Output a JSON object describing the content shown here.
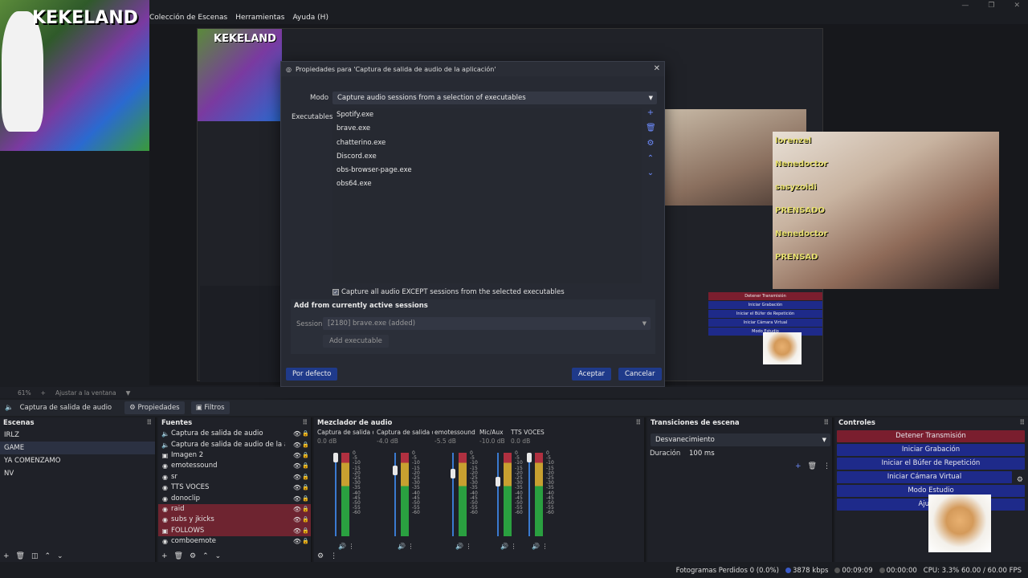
{
  "app": {
    "menu": [
      "Colección de Escenas",
      "Herramientas",
      "Ayuda (H)"
    ]
  },
  "preview": {
    "logo_text": "KEKELAND",
    "chat_names": [
      "lorenzel",
      "Nenedoctor",
      "sasyzoidi",
      "PRENSADO",
      "Nenedoctor",
      "PRENSAD"
    ]
  },
  "dialog": {
    "title": "Propiedades para 'Captura de salida de audio de la aplicación'",
    "mode_label": "Modo",
    "mode_value": "Capture audio sessions from a selection of executables",
    "executables_label": "Executables",
    "executables": [
      "Spotify.exe",
      "brave.exe",
      "chatterino.exe",
      "Discord.exe",
      "obs-browser-page.exe",
      "obs64.exe"
    ],
    "except_label": "Capture all audio EXCEPT sessions from the selected executables",
    "except_checked": true,
    "add_heading": "Add from currently active sessions",
    "session_label": "Session",
    "session_value": "[2180] brave.exe (added)",
    "add_executable": "Add executable",
    "defaults": "Por defecto",
    "ok": "Aceptar",
    "cancel": "Cancelar"
  },
  "zoom": {
    "percent": "61%",
    "fit": "Ajustar a la ventana"
  },
  "source_toolbar": {
    "name": "Captura de salida de audio",
    "properties": "Propiedades",
    "filters": "Filtros"
  },
  "scenes": {
    "title": "Escenas",
    "items": [
      "IRLZ",
      "GAME",
      "YA COMENZAMO",
      "NV"
    ],
    "selected_index": 1
  },
  "sources": {
    "title": "Fuentes",
    "items": [
      {
        "name": "Captura de salida de audio",
        "icon": "speaker-icon",
        "highlight": false
      },
      {
        "name": "Captura de salida de audio de la apli",
        "icon": "speaker-icon",
        "highlight": false
      },
      {
        "name": "Imagen 2",
        "icon": "image-icon",
        "highlight": false
      },
      {
        "name": "emotessound",
        "icon": "globe-icon",
        "highlight": false
      },
      {
        "name": "sr",
        "icon": "globe-icon",
        "highlight": false
      },
      {
        "name": "TTS VOCES",
        "icon": "globe-icon",
        "highlight": false
      },
      {
        "name": "donoclip",
        "icon": "globe-icon",
        "highlight": false
      },
      {
        "name": "raid",
        "icon": "globe-icon",
        "highlight": true
      },
      {
        "name": "subs y jkicks",
        "icon": "globe-icon",
        "highlight": true
      },
      {
        "name": "FOLLOWS",
        "icon": "image-icon",
        "highlight": true
      },
      {
        "name": "comboemote",
        "icon": "globe-icon",
        "highlight": false
      }
    ]
  },
  "mixer": {
    "title": "Mezclador de audio",
    "scale": [
      "0",
      "-5",
      "-10",
      "-15",
      "-20",
      "-25",
      "-30",
      "-35",
      "-40",
      "-45",
      "-50",
      "-55",
      "-60"
    ],
    "channels": [
      {
        "name": "Captura de salida de",
        "db": "0.0 dB"
      },
      {
        "name": "Captura de salida de",
        "db": "-4.0 dB"
      },
      {
        "name": "emotessound",
        "db": "-5.5 dB"
      },
      {
        "name": "Mic/Aux",
        "db": "-10.0 dB"
      },
      {
        "name": "TTS VOCES",
        "db": "0.0 dB"
      }
    ]
  },
  "transitions": {
    "title": "Transiciones de escena",
    "selected": "Desvanecimiento",
    "duration_label": "Duración",
    "duration_value": "100 ms"
  },
  "controls": {
    "title": "Controles",
    "buttons": [
      "Detener Transmisión",
      "Iniciar Grabación",
      "Iniciar el Búfer de Repetición",
      "Iniciar Cámara Virtual",
      "Modo Estudio",
      "Ajustes"
    ]
  },
  "status": {
    "dropped": "Fotogramas Perdidos 0 (0.0%)",
    "kbps": "3878 kbps",
    "stream_time": "00:09:09",
    "rec_time": "00:00:00",
    "cpu": "CPU: 3.3% 60.00 / 60.00 FPS"
  }
}
